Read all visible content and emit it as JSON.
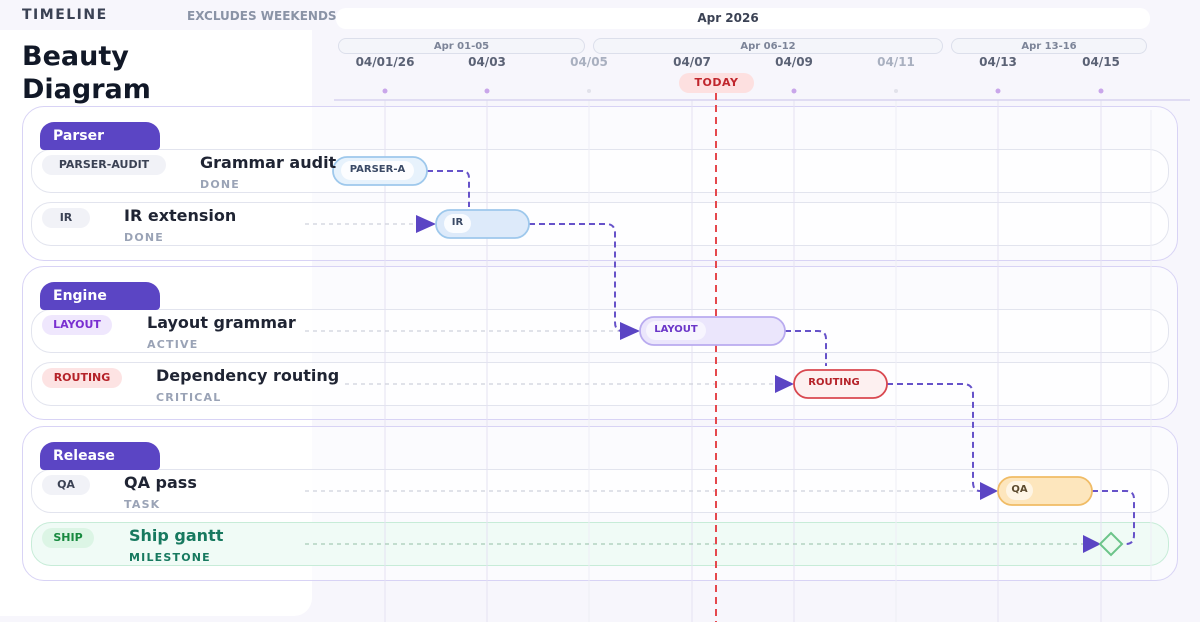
{
  "header": {
    "section": "TIMELINE",
    "note": "EXCLUDES WEEKENDS",
    "month": "Apr 2026"
  },
  "diagram_title": "Beauty Diagram",
  "weeks": [
    "Apr 01-05",
    "Apr 06-12",
    "Apr 13-16"
  ],
  "dates": [
    {
      "label": "04/01/26",
      "workday": true
    },
    {
      "label": "04/03",
      "workday": true
    },
    {
      "label": "04/05",
      "workday": false
    },
    {
      "label": "04/07",
      "workday": true
    },
    {
      "label": "04/09",
      "workday": true
    },
    {
      "label": "04/11",
      "workday": false
    },
    {
      "label": "04/13",
      "workday": true
    },
    {
      "label": "04/15",
      "workday": true
    }
  ],
  "today_label": "TODAY",
  "groups": [
    {
      "name": "Parser",
      "tasks": [
        {
          "id": "PARSER-AUDIT",
          "name": "Grammar audit",
          "status": "DONE",
          "bar_label": "PARSER-A"
        },
        {
          "id": "IR",
          "name": "IR extension",
          "status": "DONE",
          "bar_label": "IR"
        }
      ]
    },
    {
      "name": "Engine",
      "tasks": [
        {
          "id": "LAYOUT",
          "name": "Layout grammar",
          "status": "ACTIVE",
          "bar_label": "LAYOUT"
        },
        {
          "id": "ROUTING",
          "name": "Dependency routing",
          "status": "CRITICAL",
          "bar_label": "ROUTING"
        }
      ]
    },
    {
      "name": "Release",
      "tasks": [
        {
          "id": "QA",
          "name": "QA pass",
          "status": "TASK",
          "bar_label": "QA"
        },
        {
          "id": "SHIP",
          "name": "Ship gantt",
          "status": "MILESTONE",
          "bar_label": ""
        }
      ]
    }
  ],
  "colors": {
    "accent": "#5b45c4",
    "today": "#e5484d",
    "done": "#bcd9f2",
    "active": "#e8e2fb",
    "critical": "#fde8e8",
    "task": "#fde4b8",
    "milestone": "#6cc48a"
  }
}
